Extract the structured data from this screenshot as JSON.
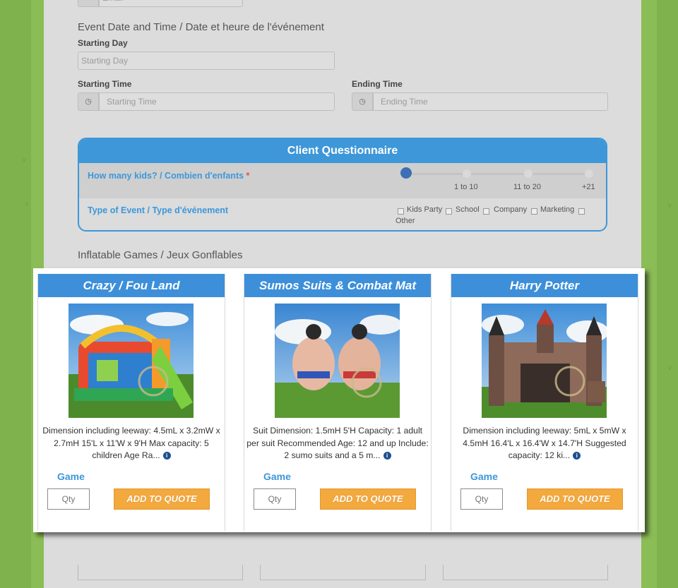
{
  "form": {
    "email_placeholder": "Email",
    "event_section_title": "Event Date and Time / Date et heure de l'événement",
    "starting_day_label": "Starting Day",
    "starting_day_placeholder": "Starting Day",
    "starting_time_label": "Starting Time",
    "starting_time_placeholder": "Starting Time",
    "ending_time_label": "Ending Time",
    "ending_time_placeholder": "Ending Time",
    "clock_icon": "clock-icon"
  },
  "questionnaire": {
    "title": "Client Questionnaire",
    "kids_label": "How many kids? / Combien d'enfants",
    "required_mark": "*",
    "slider_stops": [
      "1 to 10",
      "11 to 20",
      "+21"
    ],
    "slider_value_fraction": 0,
    "event_type_label": "Type of Event / Type d'événement",
    "event_types": [
      "Kids Party",
      "School",
      "Company",
      "Marketing",
      "Other"
    ]
  },
  "inflatables": {
    "section_title": "Inflatable Games / Jeux Gonflables",
    "products": [
      {
        "title": "Crazy / Fou Land",
        "description": "Dimension including leeway: 4.5mL x 3.2mW x 2.7mH    15'L x 11'W x 9'H Max capacity: 5 children Age Ra...",
        "category": "Game",
        "qty_placeholder": "Qty",
        "button": "ADD TO QUOTE"
      },
      {
        "title": "Sumos Suits & Combat Mat",
        "description": "Suit Dimension: 1.5mH 5'H Capacity: 1 adult per suit Recommended Age: 12 and up Include: 2 sumo suits and a 5 m...",
        "category": "Game",
        "qty_placeholder": "Qty",
        "button": "ADD TO QUOTE"
      },
      {
        "title": "Harry Potter",
        "description": "Dimension including leeway: 5mL x 5mW x 4.5mH    16.4'L x 16.4'W x 14.7'H Suggested capacity: 12 ki...",
        "category": "Game",
        "qty_placeholder": "Qty",
        "button": "ADD TO QUOTE"
      }
    ]
  },
  "colors": {
    "accent_blue": "#3d97d9",
    "button_orange": "#f3a93e",
    "background_green": "#8bbd57"
  }
}
